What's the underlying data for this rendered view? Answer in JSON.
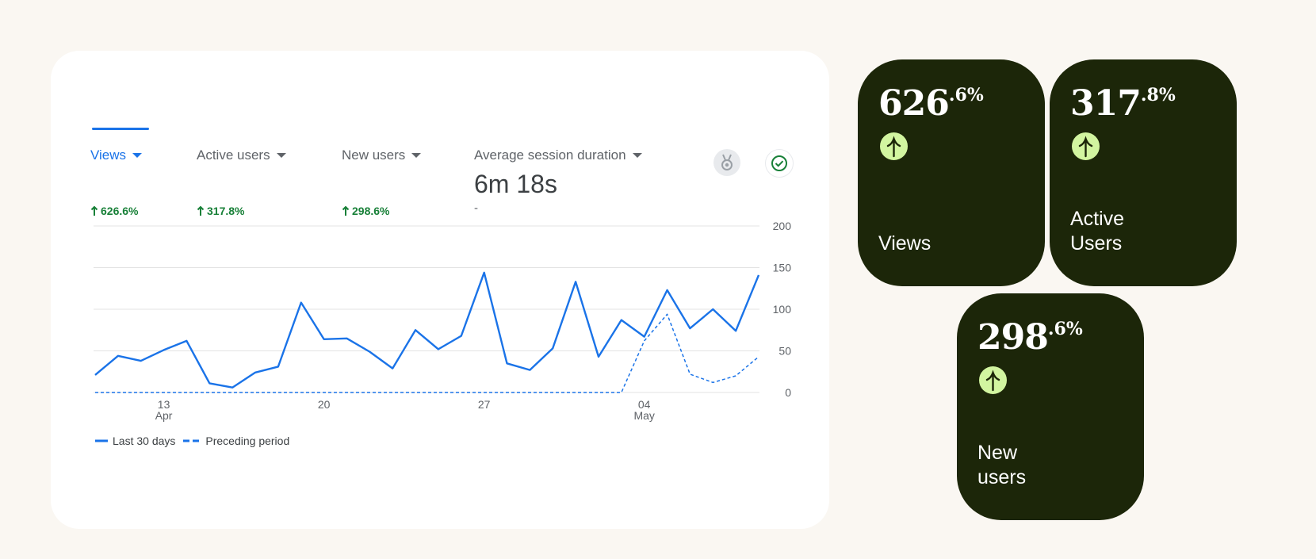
{
  "colors": {
    "accent": "#1a73e8",
    "positive": "#188038",
    "tile_bg": "#1c2609",
    "tile_icon": "#d2f5a0",
    "page_bg": "#faf7f2"
  },
  "metrics": [
    {
      "label": "Views",
      "change": "626.6%",
      "active": true
    },
    {
      "label": "Active users",
      "change": "317.8%",
      "active": false
    },
    {
      "label": "New users",
      "change": "298.6%",
      "active": false
    },
    {
      "label": "Average session duration",
      "value": "6m 18s",
      "change": "-",
      "active": false
    }
  ],
  "icons": {
    "change": "arrow-up-icon",
    "caret": "caret-down-icon",
    "badge": "medal-icon",
    "check": "check-circle-icon",
    "tile": "arrow-up-icon"
  },
  "chart_data": {
    "type": "line",
    "x": [
      "Apr 10",
      "Apr 11",
      "Apr 12",
      "Apr 13",
      "Apr 14",
      "Apr 15",
      "Apr 16",
      "Apr 17",
      "Apr 18",
      "Apr 19",
      "Apr 20",
      "Apr 21",
      "Apr 22",
      "Apr 23",
      "Apr 24",
      "Apr 25",
      "Apr 26",
      "Apr 27",
      "Apr 28",
      "Apr 29",
      "Apr 30",
      "May 1",
      "May 2",
      "May 3",
      "May 4",
      "May 5",
      "May 6",
      "May 7",
      "May 8",
      "May 9"
    ],
    "ylim": [
      0,
      200
    ],
    "y_ticks": [
      "0",
      "50",
      "100",
      "150",
      "200"
    ],
    "x_ticks": [
      {
        "index": 3,
        "day": "13",
        "month": "Apr"
      },
      {
        "index": 10,
        "day": "20",
        "month": ""
      },
      {
        "index": 17,
        "day": "27",
        "month": ""
      },
      {
        "index": 24,
        "day": "04",
        "month": "May"
      }
    ],
    "series": [
      {
        "name": "Last 30 days",
        "style": "solid",
        "values": [
          21,
          44,
          38,
          51,
          62,
          11,
          6,
          24,
          31,
          108,
          64,
          65,
          49,
          29,
          75,
          52,
          68,
          144,
          35,
          27,
          53,
          133,
          43,
          87,
          67,
          123,
          77,
          100,
          74,
          141
        ]
      },
      {
        "name": "Preceding period",
        "style": "dashed",
        "values": [
          0,
          0,
          0,
          0,
          0,
          0,
          0,
          0,
          0,
          0,
          0,
          0,
          0,
          0,
          0,
          0,
          0,
          0,
          0,
          0,
          0,
          0,
          0,
          0,
          62,
          94,
          22,
          12,
          20,
          43
        ]
      }
    ],
    "grid": true,
    "legend_position": "bottom-left"
  },
  "tiles": [
    {
      "main": "626",
      "sup": ".6%",
      "label": "Views"
    },
    {
      "main": "317",
      "sup": ".8%",
      "label": "Active\nUsers"
    },
    {
      "main": "298",
      "sup": ".6%",
      "label": "New\nusers"
    }
  ]
}
